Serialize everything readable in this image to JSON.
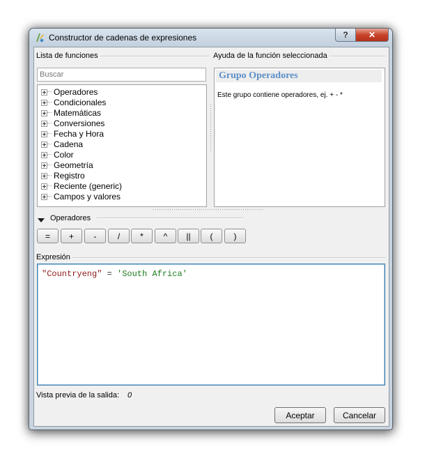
{
  "window": {
    "title": "Constructor de cadenas de expresiones",
    "help_button": "?",
    "close_button": "✕"
  },
  "functions": {
    "group_label": "Lista de funciones",
    "search_placeholder": "Buscar",
    "items": [
      {
        "label": "Operadores"
      },
      {
        "label": "Condicionales"
      },
      {
        "label": "Matemáticas"
      },
      {
        "label": "Conversiones"
      },
      {
        "label": "Fecha y Hora"
      },
      {
        "label": "Cadena"
      },
      {
        "label": "Color"
      },
      {
        "label": "Geometría"
      },
      {
        "label": "Registro"
      },
      {
        "label": "Reciente (generic)"
      },
      {
        "label": "Campos y valores"
      }
    ]
  },
  "help": {
    "group_label": "Ayuda de la función seleccionada",
    "title": "Grupo Operadores",
    "description": "Este grupo contiene operadores, ej. + - *"
  },
  "operators": {
    "label": "Operadores",
    "buttons": [
      "=",
      "+",
      "-",
      "/",
      "*",
      "^",
      "||",
      "(",
      ")"
    ]
  },
  "expression": {
    "group_label": "Expresión",
    "field": "\"Countryeng\"",
    "operator": "=",
    "string": "'South Africa'"
  },
  "preview": {
    "label": "Vista previa de la salida:",
    "value": "0"
  },
  "buttons": {
    "accept": "Aceptar",
    "cancel": "Cancelar"
  },
  "colors": {
    "help_title": "#5b8fc7",
    "field_token": "#8b1a1a",
    "string_token": "#1d7b1d",
    "focus_border": "#3c7fb1"
  },
  "icons": {
    "app": "qgis-expression-icon",
    "collapse": "triangle-down-icon",
    "expand": "plus-box-icon"
  }
}
